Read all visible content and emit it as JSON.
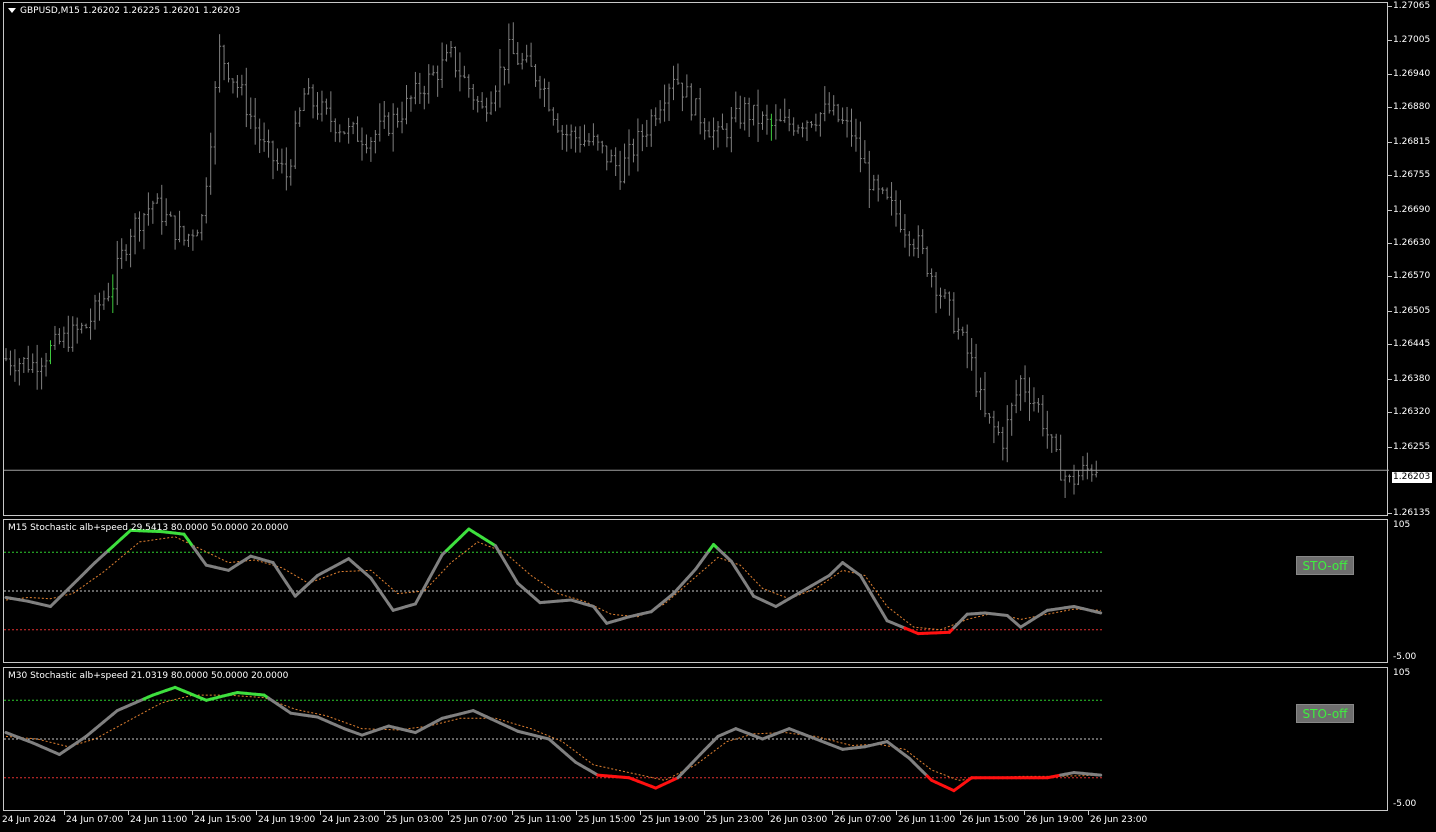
{
  "main": {
    "symbol_dropdown_icon": "triangle-down-icon",
    "title": "GBPUSD,M15  1.26202 1.26225 1.26201 1.26203",
    "price_labels": [
      "1.27065",
      "1.27005",
      "1.26940",
      "1.26880",
      "1.26815",
      "1.26755",
      "1.26690",
      "1.26630",
      "1.26570",
      "1.26505",
      "1.26445",
      "1.26380",
      "1.26320",
      "1.26255",
      "1.26135"
    ],
    "current_price": "1.26203",
    "bar_color": "#808080",
    "bull_marker_color": "#3ec83e"
  },
  "indicator1": {
    "title": "M15 Stochastic alb+speed  29.5413 80.0000 50.0000 20.0000",
    "scale_top": "105",
    "scale_bottom": "-5.00",
    "button_label": "STO-off"
  },
  "indicator2": {
    "title": "M30 Stochastic alb+speed  21.0319 80.0000 50.0000 20.0000",
    "scale_top": "105",
    "scale_bottom": "-5.00",
    "button_label": "STO-off"
  },
  "colors": {
    "overbought_level": "#2ecc2e",
    "mid_level": "#c8c8c8",
    "oversold_level": "#e03030",
    "main_line": "#808080",
    "signal_line": "#e08030",
    "up_segment": "#3ee03e",
    "down_segment": "#ff1010"
  },
  "time_labels": [
    "24 Jun 2024",
    "24 Jun 07:00",
    "24 Jun 11:00",
    "24 Jun 15:00",
    "24 Jun 19:00",
    "24 Jun 23:00",
    "25 Jun 03:00",
    "25 Jun 07:00",
    "25 Jun 11:00",
    "25 Jun 15:00",
    "25 Jun 19:00",
    "25 Jun 23:00",
    "26 Jun 03:00",
    "26 Jun 07:00",
    "26 Jun 11:00",
    "26 Jun 15:00",
    "26 Jun 19:00",
    "26 Jun 23:00"
  ],
  "chart_data": [
    {
      "type": "ohlc",
      "series": [
        {
          "name": "GBPUSD,M15"
        }
      ],
      "ylim": [
        1.2612,
        1.2707
      ],
      "close_path": [
        [
          0,
          1.2641
        ],
        [
          6,
          1.264
        ],
        [
          12,
          1.2644
        ],
        [
          18,
          1.2647
        ],
        [
          24,
          1.2655
        ],
        [
          28,
          1.2665
        ],
        [
          33,
          1.267
        ],
        [
          40,
          1.2663
        ],
        [
          44,
          1.2667
        ],
        [
          48,
          1.2698
        ],
        [
          53,
          1.269
        ],
        [
          58,
          1.268
        ],
        [
          63,
          1.2675
        ],
        [
          67,
          1.269
        ],
        [
          72,
          1.2686
        ],
        [
          77,
          1.2683
        ],
        [
          82,
          1.2682
        ],
        [
          88,
          1.2686
        ],
        [
          93,
          1.2691
        ],
        [
          100,
          1.2697
        ],
        [
          107,
          1.2687
        ],
        [
          113,
          1.2698
        ],
        [
          120,
          1.2693
        ],
        [
          125,
          1.2683
        ],
        [
          132,
          1.2681
        ],
        [
          138,
          1.2676
        ],
        [
          144,
          1.2684
        ],
        [
          150,
          1.2694
        ],
        [
          155,
          1.2687
        ],
        [
          160,
          1.2682
        ],
        [
          166,
          1.2687
        ],
        [
          172,
          1.2684
        ],
        [
          178,
          1.2685
        ],
        [
          185,
          1.2687
        ],
        [
          190,
          1.2683
        ],
        [
          195,
          1.2672
        ],
        [
          200,
          1.2668
        ],
        [
          205,
          1.2662
        ],
        [
          209,
          1.2655
        ],
        [
          213,
          1.2648
        ],
        [
          217,
          1.264
        ],
        [
          220,
          1.263
        ],
        [
          224,
          1.2626
        ],
        [
          228,
          1.2637
        ],
        [
          232,
          1.2632
        ],
        [
          236,
          1.2622
        ],
        [
          239,
          1.2618
        ],
        [
          242,
          1.262
        ],
        [
          245,
          1.2621
        ]
      ]
    },
    {
      "type": "line",
      "series": [
        {
          "name": "M15 Stochastic alb+speed"
        }
      ],
      "ylim": [
        -5,
        105
      ],
      "levels": [
        80,
        50,
        20
      ],
      "main": [
        [
          0,
          45
        ],
        [
          5,
          42
        ],
        [
          10,
          38
        ],
        [
          15,
          55
        ],
        [
          20,
          72
        ],
        [
          28,
          97
        ],
        [
          35,
          96
        ],
        [
          40,
          94
        ],
        [
          45,
          70
        ],
        [
          50,
          66
        ],
        [
          55,
          77
        ],
        [
          60,
          72
        ],
        [
          65,
          46
        ],
        [
          70,
          62
        ],
        [
          77,
          75
        ],
        [
          82,
          60
        ],
        [
          87,
          35
        ],
        [
          92,
          40
        ],
        [
          98,
          78
        ],
        [
          104,
          98
        ],
        [
          110,
          85
        ],
        [
          115,
          56
        ],
        [
          120,
          41
        ],
        [
          127,
          43
        ],
        [
          132,
          38
        ],
        [
          135,
          25
        ],
        [
          140,
          30
        ],
        [
          145,
          34
        ],
        [
          150,
          48
        ],
        [
          155,
          67
        ],
        [
          159,
          86
        ],
        [
          163,
          73
        ],
        [
          168,
          46
        ],
        [
          173,
          38
        ],
        [
          178,
          48
        ],
        [
          185,
          62
        ],
        [
          188,
          72
        ],
        [
          192,
          62
        ],
        [
          198,
          27
        ],
        [
          205,
          17
        ],
        [
          212,
          18
        ],
        [
          216,
          32
        ],
        [
          220,
          33
        ],
        [
          225,
          31
        ],
        [
          228,
          22
        ],
        [
          234,
          35
        ],
        [
          240,
          38
        ],
        [
          246,
          33
        ]
      ],
      "signal": [
        [
          0,
          43
        ],
        [
          5,
          45
        ],
        [
          10,
          44
        ],
        [
          15,
          48
        ],
        [
          22,
          65
        ],
        [
          30,
          88
        ],
        [
          38,
          92
        ],
        [
          44,
          82
        ],
        [
          50,
          72
        ],
        [
          56,
          74
        ],
        [
          62,
          68
        ],
        [
          68,
          56
        ],
        [
          75,
          65
        ],
        [
          82,
          66
        ],
        [
          88,
          48
        ],
        [
          94,
          50
        ],
        [
          100,
          72
        ],
        [
          106,
          88
        ],
        [
          112,
          80
        ],
        [
          118,
          62
        ],
        [
          124,
          48
        ],
        [
          130,
          42
        ],
        [
          136,
          32
        ],
        [
          142,
          30
        ],
        [
          148,
          40
        ],
        [
          154,
          58
        ],
        [
          160,
          76
        ],
        [
          165,
          70
        ],
        [
          170,
          52
        ],
        [
          176,
          44
        ],
        [
          182,
          52
        ],
        [
          188,
          66
        ],
        [
          193,
          62
        ],
        [
          198,
          38
        ],
        [
          204,
          22
        ],
        [
          210,
          20
        ],
        [
          216,
          28
        ],
        [
          222,
          33
        ],
        [
          228,
          28
        ],
        [
          234,
          32
        ],
        [
          240,
          36
        ],
        [
          246,
          35
        ]
      ]
    },
    {
      "type": "line",
      "series": [
        {
          "name": "M30 Stochastic alb+speed"
        }
      ],
      "ylim": [
        -5,
        105
      ],
      "levels": [
        80,
        50,
        20
      ],
      "main": [
        [
          0,
          55
        ],
        [
          6,
          47
        ],
        [
          12,
          38
        ],
        [
          18,
          52
        ],
        [
          25,
          72
        ],
        [
          33,
          84
        ],
        [
          38,
          90
        ],
        [
          45,
          80
        ],
        [
          52,
          86
        ],
        [
          58,
          84
        ],
        [
          64,
          70
        ],
        [
          70,
          67
        ],
        [
          76,
          58
        ],
        [
          80,
          53
        ],
        [
          86,
          60
        ],
        [
          92,
          55
        ],
        [
          98,
          66
        ],
        [
          105,
          72
        ],
        [
          110,
          64
        ],
        [
          115,
          56
        ],
        [
          122,
          50
        ],
        [
          128,
          32
        ],
        [
          133,
          22
        ],
        [
          140,
          20
        ],
        [
          146,
          12
        ],
        [
          151,
          20
        ],
        [
          156,
          38
        ],
        [
          160,
          52
        ],
        [
          164,
          58
        ],
        [
          170,
          50
        ],
        [
          176,
          58
        ],
        [
          182,
          50
        ],
        [
          188,
          42
        ],
        [
          193,
          44
        ],
        [
          198,
          48
        ],
        [
          203,
          35
        ],
        [
          208,
          18
        ],
        [
          213,
          10
        ],
        [
          217,
          20
        ],
        [
          222,
          20
        ],
        [
          228,
          20
        ],
        [
          234,
          20
        ],
        [
          240,
          24
        ],
        [
          246,
          22
        ]
      ],
      "signal": [
        [
          0,
          52
        ],
        [
          7,
          50
        ],
        [
          14,
          44
        ],
        [
          20,
          50
        ],
        [
          28,
          65
        ],
        [
          35,
          78
        ],
        [
          42,
          84
        ],
        [
          50,
          84
        ],
        [
          58,
          82
        ],
        [
          65,
          73
        ],
        [
          72,
          68
        ],
        [
          80,
          58
        ],
        [
          88,
          57
        ],
        [
          95,
          60
        ],
        [
          102,
          66
        ],
        [
          110,
          66
        ],
        [
          118,
          58
        ],
        [
          125,
          48
        ],
        [
          132,
          30
        ],
        [
          140,
          24
        ],
        [
          148,
          18
        ],
        [
          155,
          30
        ],
        [
          162,
          48
        ],
        [
          168,
          54
        ],
        [
          175,
          55
        ],
        [
          182,
          52
        ],
        [
          190,
          45
        ],
        [
          196,
          46
        ],
        [
          202,
          42
        ],
        [
          208,
          26
        ],
        [
          214,
          18
        ],
        [
          220,
          20
        ],
        [
          228,
          21
        ],
        [
          236,
          21
        ],
        [
          246,
          22
        ]
      ]
    }
  ]
}
